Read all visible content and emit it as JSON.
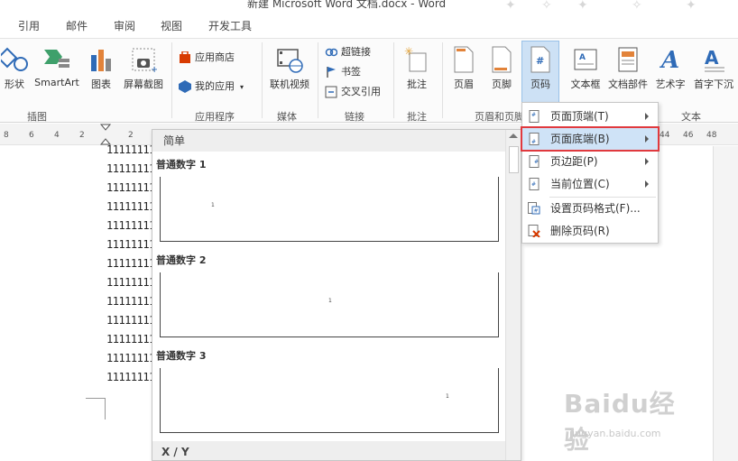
{
  "window": {
    "title": "新建 Microsoft Word 文档.docx - Word"
  },
  "menu_tabs": [
    "引用",
    "邮件",
    "审阅",
    "视图",
    "开发工具"
  ],
  "ribbon": {
    "buttons": {
      "shapes": "形状",
      "smartart": "SmartArt",
      "chart": "图表",
      "screenshot": "屏幕截图",
      "app_store": "应用商店",
      "my_apps": "我的应用",
      "online_video": "联机视频",
      "hyperlink": "超链接",
      "bookmark": "书签",
      "cross_ref": "交叉引用",
      "comment": "批注",
      "header": "页眉",
      "footer": "页脚",
      "page_number": "页码",
      "textbox": "文本框",
      "quick_parts": "文档部件",
      "wordart": "艺术字",
      "dropcap": "首字下沉"
    },
    "groups": {
      "illustrations": "插图",
      "apps": "应用程序",
      "media": "媒体",
      "links": "链接",
      "comments": "批注",
      "header_footer": "页眉和页脚",
      "text": "文本"
    }
  },
  "ruler": {
    "left_numbers": [
      "8",
      "6",
      "4",
      "2",
      "2"
    ],
    "right_numbers": [
      "44",
      "46",
      "48"
    ]
  },
  "document": {
    "lines": [
      "11111111",
      "11111111",
      "11111111",
      "11111111",
      "11111111",
      "11111111",
      "11111111",
      "11111111",
      "11111111",
      "11111111",
      "11111111",
      "11111111",
      "11111111"
    ]
  },
  "gallery": {
    "section_simple": "简单",
    "items": [
      {
        "title": "普通数字 1",
        "num": "1"
      },
      {
        "title": "普通数字 2",
        "num": "1"
      },
      {
        "title": "普通数字 3",
        "num": "1"
      }
    ],
    "section_xy": "X / Y"
  },
  "page_number_menu": {
    "items": [
      {
        "label": "页面顶端(T)",
        "submenu": true
      },
      {
        "label": "页面底端(B)",
        "submenu": true,
        "selected": true
      },
      {
        "label": "页边距(P)",
        "submenu": true
      },
      {
        "label": "当前位置(C)",
        "submenu": true
      },
      {
        "label": "设置页码格式(F)...",
        "submenu": false
      },
      {
        "label": "删除页码(R)",
        "submenu": false
      }
    ]
  },
  "watermark": {
    "brand": "Baidu经验",
    "url": "jingyan.baidu.com"
  },
  "colors": {
    "accent": "#2b579a",
    "selected_bg": "#cfe3f7",
    "highlight_border": "#e0393e"
  }
}
